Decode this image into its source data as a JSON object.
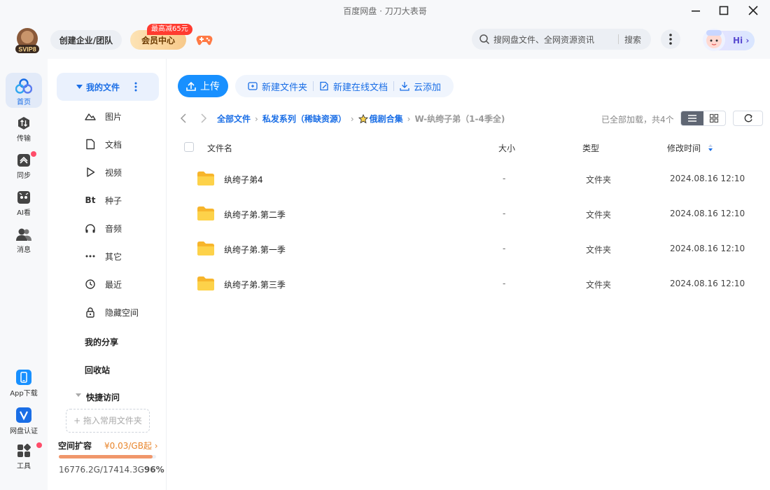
{
  "window": {
    "title": "百度网盘 · 刀刀大表哥"
  },
  "header": {
    "vip_level": "SVIP8",
    "enterprise_label": "创建企业/团队",
    "member_center_label": "会员中心",
    "promo_badge": "最高减65元",
    "search_placeholder": "搜网盘文件、全网资源资讯",
    "search_button": "搜索",
    "hi_label": "Hi"
  },
  "rail": {
    "items": [
      {
        "label": "首页"
      },
      {
        "label": "传输"
      },
      {
        "label": "同步"
      },
      {
        "label": "AI看"
      },
      {
        "label": "消息"
      },
      {
        "label": "App下载"
      },
      {
        "label": "网盘认证"
      },
      {
        "label": "工具"
      }
    ]
  },
  "sidebar": {
    "my_files": "我的文件",
    "categories": [
      {
        "label": "图片",
        "icon": "image-icon"
      },
      {
        "label": "文档",
        "icon": "document-icon"
      },
      {
        "label": "视频",
        "icon": "video-icon"
      },
      {
        "label": "种子",
        "icon": "torrent-icon",
        "glyph": "Bt"
      },
      {
        "label": "音频",
        "icon": "audio-icon"
      },
      {
        "label": "其它",
        "icon": "more-icon"
      },
      {
        "label": "最近",
        "icon": "recent-icon"
      },
      {
        "label": "隐藏空间",
        "icon": "lock-icon"
      }
    ],
    "my_share": "我的分享",
    "recycle_bin": "回收站",
    "quick_access": "快捷访问",
    "drop_hint": "+ 拖入常用文件夹",
    "quota": {
      "title": "空间扩容",
      "price": "¥0.03/GB起 ›",
      "used_total": "16776.2G/17414.3G",
      "percent_label": "96%",
      "fraction": 0.963
    }
  },
  "toolbar": {
    "upload": "上传",
    "new_folder": "新建文件夹",
    "new_online_doc": "新建在线文档",
    "cloud_add": "云添加"
  },
  "breadcrumb": {
    "items": [
      "全部文件",
      "私发系列（稀缺资源）",
      "俄剧合集"
    ],
    "current": "W-纨绔子弟（1-4季全)"
  },
  "list_info": "已全部加载，共4个",
  "table": {
    "columns": {
      "name": "文件名",
      "size": "大小",
      "type": "类型",
      "modified": "修改时间"
    },
    "rows": [
      {
        "name": "纨绔子弟4",
        "size": "-",
        "type": "文件夹",
        "modified": "2024.08.16 12:10"
      },
      {
        "name": "纨绔子弟.第二季",
        "size": "-",
        "type": "文件夹",
        "modified": "2024.08.16 12:10"
      },
      {
        "name": "纨绔子弟.第一季",
        "size": "-",
        "type": "文件夹",
        "modified": "2024.08.16 12:10"
      },
      {
        "name": "纨绔子弟.第三季",
        "size": "-",
        "type": "文件夹",
        "modified": "2024.08.16 12:10"
      }
    ]
  },
  "colors": {
    "accent": "#1890ff",
    "link": "#1a6ee6",
    "folder": "#fccc3c",
    "quota_bar": "#f0976b",
    "price": "#e8842a"
  }
}
